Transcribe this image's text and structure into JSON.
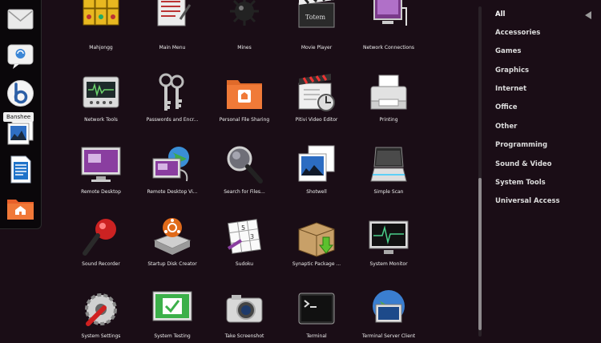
{
  "dock": {
    "items": [
      {
        "name": "mail-app-icon"
      },
      {
        "name": "chat-app-icon"
      },
      {
        "name": "banshee-app-icon"
      },
      {
        "name": "photos-app-icon"
      },
      {
        "name": "writer-app-icon"
      },
      {
        "name": "home-folder-icon"
      }
    ],
    "tooltip": "Banshee"
  },
  "apps": [
    {
      "label": "Mahjongg",
      "icon": "mahjongg-icon"
    },
    {
      "label": "Main Menu",
      "icon": "main-menu-icon"
    },
    {
      "label": "Mines",
      "icon": "mines-icon"
    },
    {
      "label": "Movie Player",
      "icon": "movie-player-icon"
    },
    {
      "label": "Network Connections",
      "icon": "network-connections-icon"
    },
    {
      "label": "Network Tools",
      "icon": "network-tools-icon"
    },
    {
      "label": "Passwords and Encr...",
      "icon": "keys-icon"
    },
    {
      "label": "Personal File Sharing",
      "icon": "shared-folder-icon"
    },
    {
      "label": "Pitivi Video Editor",
      "icon": "video-editor-icon"
    },
    {
      "label": "Printing",
      "icon": "printer-icon"
    },
    {
      "label": "Remote Desktop",
      "icon": "remote-desktop-icon"
    },
    {
      "label": "Remote Desktop Vi...",
      "icon": "remote-desktop-viewer-icon"
    },
    {
      "label": "Search for Files...",
      "icon": "magnifier-icon"
    },
    {
      "label": "Shotwell",
      "icon": "shotwell-icon"
    },
    {
      "label": "Simple Scan",
      "icon": "scanner-icon"
    },
    {
      "label": "Sound Recorder",
      "icon": "microphone-icon"
    },
    {
      "label": "Startup Disk Creator",
      "icon": "startup-disk-icon"
    },
    {
      "label": "Sudoku",
      "icon": "sudoku-icon"
    },
    {
      "label": "Synaptic Package ...",
      "icon": "package-icon"
    },
    {
      "label": "System Monitor",
      "icon": "system-monitor-icon"
    },
    {
      "label": "System Settings",
      "icon": "settings-icon"
    },
    {
      "label": "System Testing",
      "icon": "system-testing-icon"
    },
    {
      "label": "Take Screenshot",
      "icon": "camera-icon"
    },
    {
      "label": "Terminal",
      "icon": "terminal-icon"
    },
    {
      "label": "Terminal Server Client",
      "icon": "terminal-server-icon"
    }
  ],
  "categories": [
    {
      "label": "All",
      "active": true
    },
    {
      "label": "Accessories"
    },
    {
      "label": "Games"
    },
    {
      "label": "Graphics"
    },
    {
      "label": "Internet"
    },
    {
      "label": "Office"
    },
    {
      "label": "Other"
    },
    {
      "label": "Programming"
    },
    {
      "label": "Sound & Video"
    },
    {
      "label": "System Tools"
    },
    {
      "label": "Universal Access"
    }
  ]
}
